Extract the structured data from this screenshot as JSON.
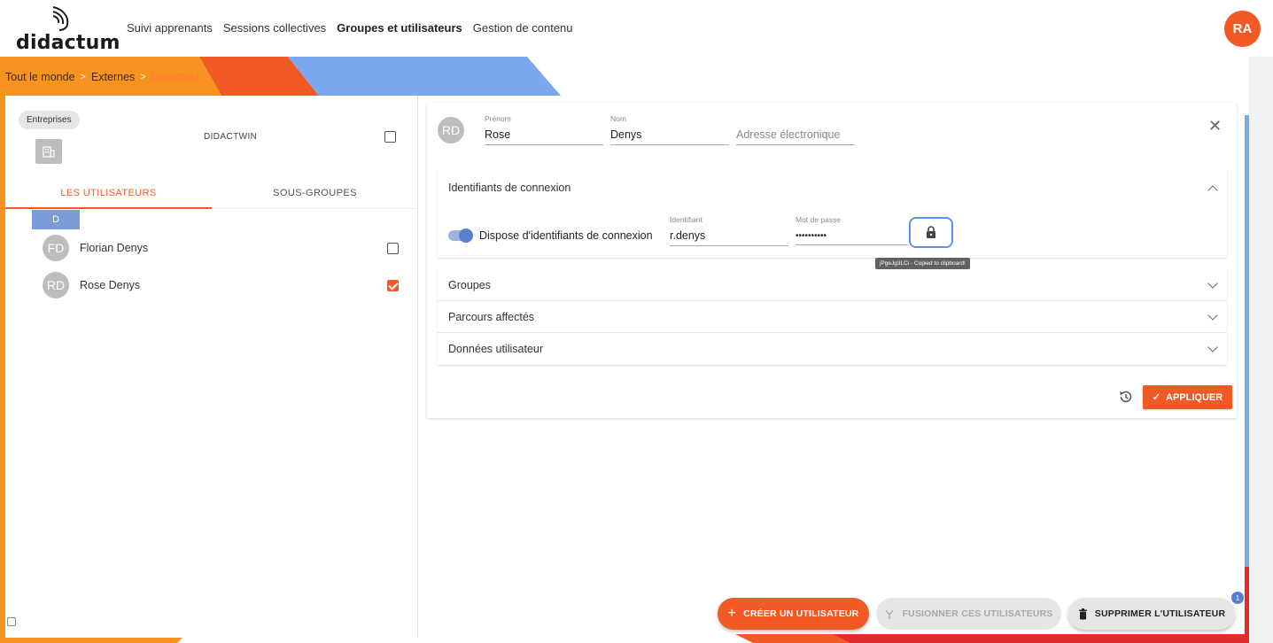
{
  "app": {
    "logo_text": "didactum",
    "nav": [
      "Suivi apprenants",
      "Sessions collectives",
      "Groupes et utilisateurs",
      "Gestion de contenu"
    ],
    "active_nav": "Groupes et utilisateurs",
    "avatar_initials": "RA"
  },
  "breadcrumb": {
    "items": [
      "Tout le monde",
      "Externes"
    ],
    "separator": ">",
    "current": "Didactwin"
  },
  "left_panel": {
    "chip": "Entreprises",
    "org_name": "DIDACTWIN",
    "tabs": [
      "LES UTILISATEURS",
      "SOUS-GROUPES"
    ],
    "letter": "D",
    "users": [
      {
        "initials": "FD",
        "name": "Florian Denys",
        "checked": false
      },
      {
        "initials": "RD",
        "name": "Rose Denys",
        "checked": true
      }
    ]
  },
  "user_form": {
    "avatar_initials": "RD",
    "prenom_label": "Prénom",
    "prenom_value": "Rose",
    "nom_label": "Nom",
    "nom_value": "Denys",
    "email_placeholder": "Adresse électronique",
    "credentials": {
      "title": "Identifiants de connexion",
      "toggle_label": "Dispose d'identifiants de connexion",
      "toggle_on": true,
      "login_label": "Identifiant",
      "login_value": "r.denys",
      "password_label": "Mot de passe",
      "password_value": "••••••••••",
      "tooltip": "jPgeJg3LCi - Copied to clipboard!"
    },
    "sections": [
      "Groupes",
      "Parcours affectés",
      "Données utilisateur"
    ],
    "apply_label": "APPLIQUER"
  },
  "actions": {
    "create": "CRÉER UN UTILISATEUR",
    "merge": "FUSIONNER CES UTILISATEURS",
    "delete": "SUPPRIMER L'UTILISATEUR",
    "badge_count": "1"
  },
  "colors": {
    "accent": "#f15a24",
    "blue": "#5a7fce",
    "band_orange": "#f7931e",
    "band_blue": "#7aa9f0"
  }
}
